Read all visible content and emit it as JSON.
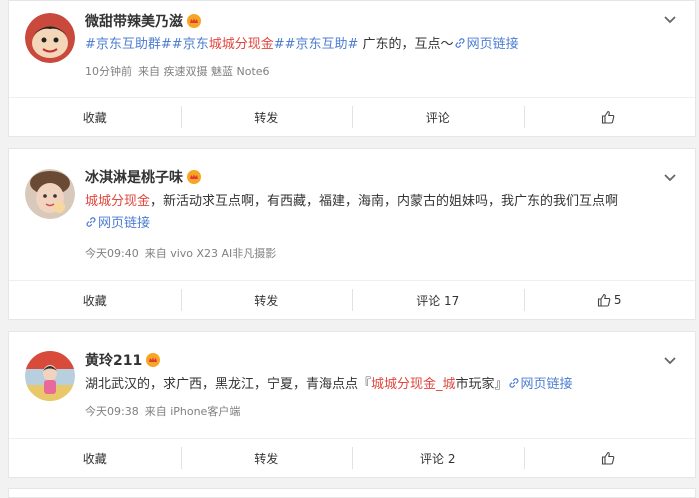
{
  "posts": [
    {
      "user": "微甜带辣美乃滋",
      "content": {
        "tag1": "#京东互助群#",
        "tag2a": "#京东",
        "hl": "城城分现金",
        "tag2b": "#",
        "tag3": "#京东互助#",
        "text": " 广东的，互点～",
        "link": "网页链接"
      },
      "meta": {
        "time": "10分钟前",
        "source": "来自 疾速双摄 魅蓝 Note6"
      },
      "actions": {
        "fav": "收藏",
        "repost": "转发",
        "comment": "评论",
        "like": ""
      }
    },
    {
      "user": "冰淇淋是桃子味",
      "content": {
        "hl": "城城分现金",
        "text": "，新活动求互点啊，有西藏，福建，海南，内蒙古的姐妹吗，我广东的我们互点啊",
        "link": "网页链接"
      },
      "meta": {
        "time": "今天09:40",
        "source": "来自 vivo X23 AI非凡摄影"
      },
      "actions": {
        "fav": "收藏",
        "repost": "转发",
        "comment": "评论 17",
        "like": "5"
      }
    },
    {
      "user": "黄玲211",
      "content": {
        "text": "湖北武汉的，求广西，黑龙江，宁夏，青海点点『",
        "hl": "城城分现金_城",
        "text2": "市玩家』",
        "link": "网页链接"
      },
      "meta": {
        "time": "今天09:38",
        "source": "来自 iPhone客户端"
      },
      "actions": {
        "fav": "收藏",
        "repost": "转发",
        "comment": "评论 2",
        "like": ""
      }
    }
  ]
}
